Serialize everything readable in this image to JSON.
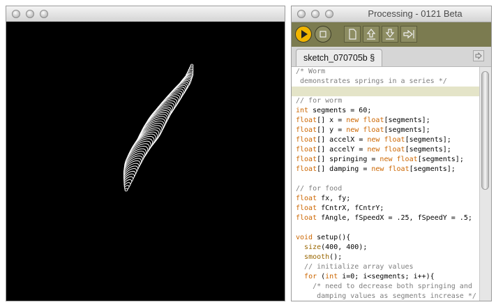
{
  "sketch_window": {
    "title": ""
  },
  "pde_window": {
    "title": "Processing - 0121 Beta",
    "toolbar": {
      "run_icon": "play-icon",
      "stop_icon": "stop-icon",
      "new_icon": "new-file-icon",
      "open_icon": "open-arrow-up-icon",
      "save_icon": "save-arrow-down-icon",
      "export_icon": "export-arrow-right-icon"
    },
    "tab": {
      "label": "sketch_070705b §"
    },
    "colors": {
      "toolbar": "#7b7b50",
      "run_button": "#f0b400",
      "comment": "#7e7e7e",
      "keyword": "#cc6600"
    }
  },
  "code_lines": [
    "/* Worm",
    " demonstrates springs in a series */",
    "",
    "// for worm",
    "int segments = 60;",
    "float[] x = new float[segments];",
    "float[] y = new float[segments];",
    "float[] accelX = new float[segments];",
    "float[] accelY = new float[segments];",
    "float[] springing = new float[segments];",
    "float[] damping = new float[segments];",
    "",
    "// for food",
    "float fx, fy;",
    "float fCntrX, fCntrY;",
    "float fAngle, fSpeedX = .25, fSpeedY = .5;",
    "",
    "void setup(){",
    "  size(400, 400);",
    "  smooth();",
    "  // initialize array values",
    "  for (int i=0; i<segments; i++){",
    "    /* need to decrease both springing and",
    "     damping values as segments increase */"
  ]
}
